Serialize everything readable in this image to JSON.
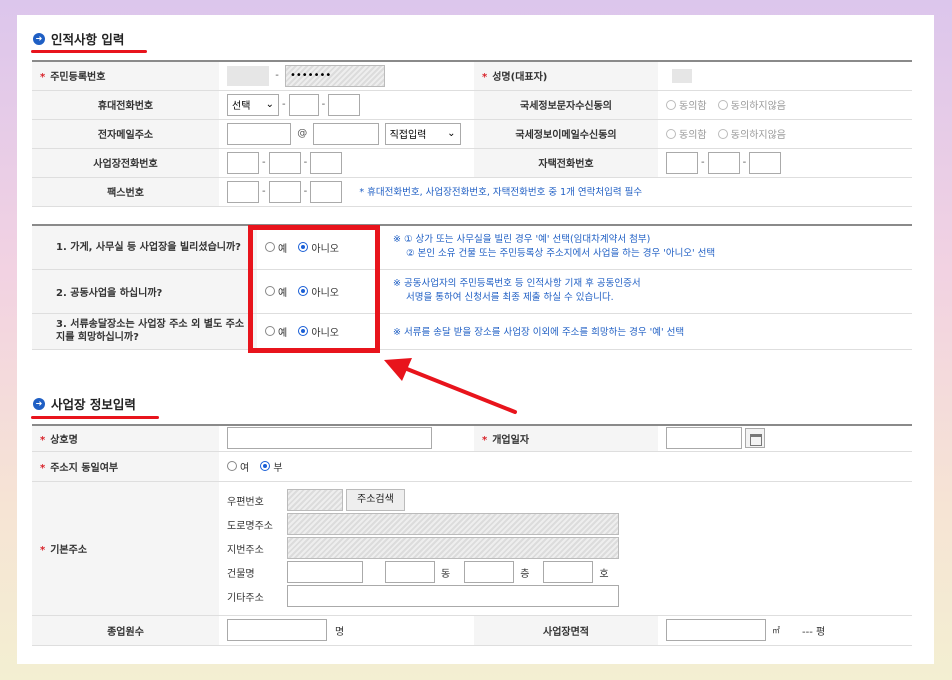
{
  "sec1": {
    "title": "인적사항 입력",
    "rrn_label": "주민등록번호",
    "rrn_masked": "•••••••",
    "name_label": "성명(대표자)",
    "mobile_label": "휴대전화번호",
    "mobile_select": "선택",
    "sms_label": "국세정보문자수신동의",
    "agree": "동의함",
    "disagree": "동의하지않음",
    "email_label": "전자메일주소",
    "email_at": "@",
    "email_select": "직접입력",
    "email_consent_label": "국세정보이메일수신동의",
    "bizphone_label": "사업장전화번호",
    "homephone_label": "자택전화번호",
    "fax_label": "팩스번호",
    "contact_note": "* 휴대전화번호, 사업장전화번호, 자택전화번호 중 1개 연락처입력 필수"
  },
  "questions": {
    "q1": "1. 가게, 사무실 등 사업장을 빌리셨습니까?",
    "q2": "2. 공동사업을 하십니까?",
    "q3": "3. 서류송달장소는 사업장 주소 외 별도 주소지를 희망하십니까?",
    "yes": "예",
    "no": "아니오",
    "note1a": "※ ① 상가 또는 사무실을 빌린 경우 '예' 선택(임대차계약서 첨부)",
    "note1b": "② 본인 소유 건물 또는 주민등록상 주소지에서 사업을 하는 경우 '아니오' 선택",
    "note2a": "※ 공동사업자의 주민등록번호 등 인적사항 기재 후 공동인증서",
    "note2b": "서명을 통하여 신청서를 최종 제출 하실 수 있습니다.",
    "note3": "※ 서류를 송달 받을 장소를 사업장 이외에 주소를 희망하는 경우 '예' 선택"
  },
  "sec2": {
    "title": "사업장 정보입력",
    "trade_label": "상호명",
    "open_label": "개업일자",
    "same_label": "주소지 동일여부",
    "same_yes": "여",
    "same_no": "부",
    "addr_label": "기본주소",
    "zip": "우편번호",
    "search_btn": "주소검색",
    "road": "도로명주소",
    "jibun": "지번주소",
    "bldg": "건물명",
    "dong": "동",
    "floor": "층",
    "ho": "호",
    "etc": "기타주소",
    "emp_label": "종업원수",
    "emp_unit": "명",
    "area_label": "사업장면적",
    "area_unit": "㎡",
    "pyeong": "--- 평"
  },
  "colors": {
    "accent": "#1f5fc4",
    "highlight": "#e8141c",
    "required": "#d8232a"
  }
}
